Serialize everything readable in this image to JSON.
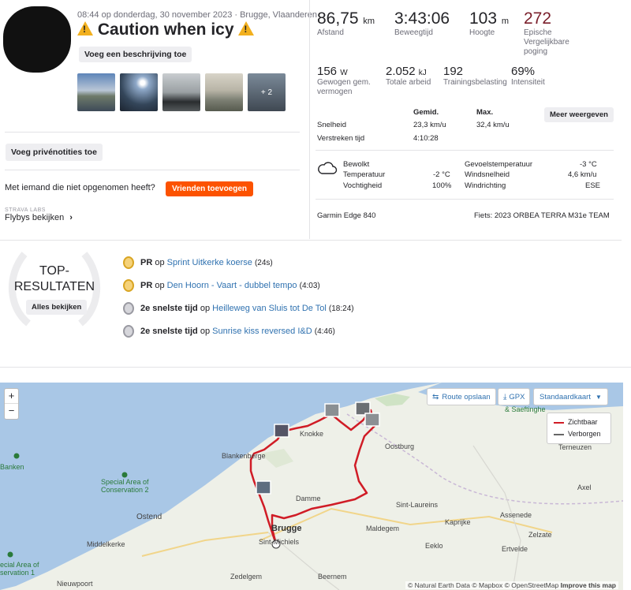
{
  "header": {
    "meta": "08:44 op donderdag, 30 november 2023 · Brugge, Vlaanderen",
    "title": "Caution when icy",
    "add_description": "Voeg een beschrijving toe",
    "photos_more": "+ 2"
  },
  "stats_primary": [
    {
      "value": "86,75",
      "unit": "km",
      "label": "Afstand"
    },
    {
      "value": "3:43:06",
      "unit": "",
      "label": "Beweegtijd"
    },
    {
      "value": "103",
      "unit": "m",
      "label": "Hoogte"
    },
    {
      "value": "272",
      "unit": "",
      "label": "Epische Vergelijkbare poging",
      "color": "#7a1f2b"
    }
  ],
  "stats_secondary": [
    {
      "value": "156",
      "unit": "W",
      "label": "Gewogen gem. vermogen"
    },
    {
      "value": "2.052",
      "unit": "kJ",
      "label": "Totale arbeid"
    },
    {
      "value": "192",
      "unit": "",
      "label": "Trainingsbelasting"
    },
    {
      "value": "69%",
      "unit": "",
      "label": "Intensiteit"
    }
  ],
  "details": {
    "col_avg": "Gemid.",
    "col_max": "Max.",
    "more_button": "Meer weergeven",
    "rows": [
      {
        "label": "Snelheid",
        "avg": "23,3 km/u",
        "max": "32,4 km/u"
      },
      {
        "label": "Verstreken tijd",
        "avg": "4:10:28",
        "max": ""
      }
    ]
  },
  "weather": {
    "left": [
      {
        "label": "Bewolkt",
        "value": ""
      },
      {
        "label": "Temperatuur",
        "value": "-2 °C"
      },
      {
        "label": "Vochtigheid",
        "value": "100%"
      }
    ],
    "right": [
      {
        "label": "Gevoelstemperatuur",
        "value": "-3 °C"
      },
      {
        "label": "Windsnelheid",
        "value": "4,6 km/u"
      },
      {
        "label": "Windrichting",
        "value": "ESE"
      }
    ]
  },
  "device": "Garmin Edge 840",
  "bike": "Fiets: 2023 ORBEA TERRA M31e TEAM",
  "left_panel": {
    "private_notes": "Voeg privénotities toe",
    "friends_text": "Met iemand die niet opgenomen heeft?",
    "friends_button": "Vrienden toevoegen",
    "flyby_label": "STRAVA LABS",
    "flyby_link": "Flybys bekijken"
  },
  "top_results": {
    "title_line1": "TOP-",
    "title_line2": "RESULTATEN",
    "view_all": "Alles bekijken",
    "items": [
      {
        "medal": "gold",
        "prefix": "PR",
        "joiner": "op",
        "segment": "Sprint Uitkerke koerse",
        "time": "(24s)"
      },
      {
        "medal": "gold",
        "prefix": "PR",
        "joiner": "op",
        "segment": "Den Hoorn - Vaart - dubbel tempo",
        "time": "(4:03)"
      },
      {
        "medal": "silver",
        "prefix": "2e snelste tijd",
        "joiner": "op",
        "segment": "Heilleweg van Sluis tot De Tol",
        "time": "(18:24)"
      },
      {
        "medal": "silver",
        "prefix": "2e snelste tijd",
        "joiner": "op",
        "segment": "Sunrise kiss reversed I&D",
        "time": "(4:46)"
      }
    ]
  },
  "map": {
    "zoom_in": "+",
    "zoom_out": "−",
    "save_route": "Route opslaan",
    "gpx": "GPX",
    "map_type": "Standaardkaart",
    "legend_visible": "Zichtbaar",
    "legend_hidden": "Verborgen",
    "attribution": "© Natural Earth Data © Mapbox © OpenStreetMap",
    "improve": "Improve this map",
    "places": {
      "knokke": "Knokke",
      "oostburg": "Oostburg",
      "blankenberge": "Blankenberge",
      "damme": "Damme",
      "brugge": "Brugge",
      "sintmichiels": "Sint-Michiels",
      "zedelgem": "Zedelgem",
      "beernem": "Beernem",
      "eeklo": "Eeklo",
      "maldegem": "Maldegem",
      "ostend": "Ostend",
      "middelkerke": "Middelkerke",
      "nieuwpoort": "Nieuwpoort",
      "sintlaureins": "Sint-Laureins",
      "kaprijke": "Kaprijke",
      "assenede": "Assenede",
      "zelzate": "Zelzate",
      "ertvelde": "Ertvelde",
      "axel": "Axel",
      "terneuzen": "Terneuzen",
      "saeftinghe": "& Saeftinghe",
      "banken": "Banken",
      "sac2_1": "Special Area of",
      "sac2_2": "Conservation 2",
      "sac1_1": "ecial Area of",
      "sac1_2": "servation 1"
    }
  },
  "colors": {
    "accent": "#fc5200",
    "route": "#d01c26",
    "link": "#3072b0",
    "sea": "#a9c7e6",
    "land": "#eef0e8"
  }
}
